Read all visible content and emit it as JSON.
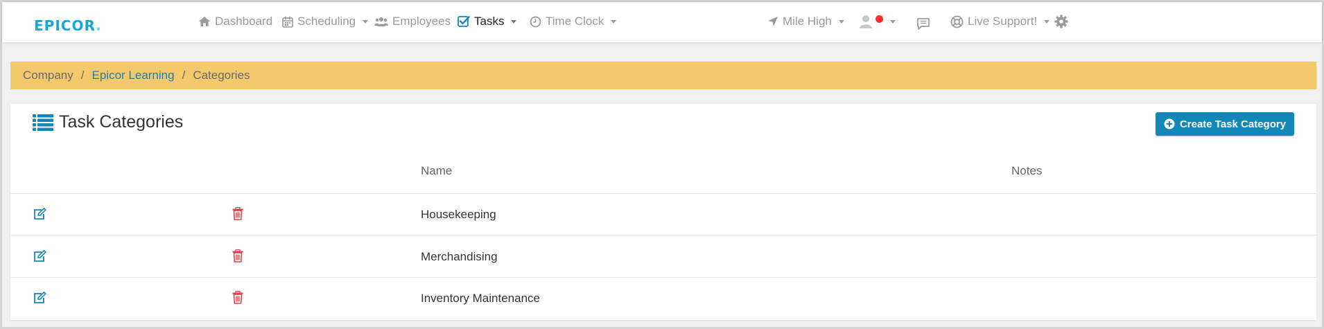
{
  "brand": {
    "logo_text": "EPICOR",
    "logo_mark": "®",
    "logo_color": "#16a9d8"
  },
  "nav": {
    "dashboard": "Dashboard",
    "scheduling": "Scheduling",
    "employees": "Employees",
    "tasks": "Tasks",
    "time_clock": "Time Clock",
    "location": "Mile High",
    "live_support": "Live Support!"
  },
  "breadcrumb": {
    "root": "Company",
    "sep": "/",
    "link": "Epicor Learning",
    "current": "Categories"
  },
  "page": {
    "title": "Task Categories",
    "create_button": "Create Task Category"
  },
  "table": {
    "columns": {
      "name": "Name",
      "notes": "Notes"
    },
    "rows": [
      {
        "name": "Housekeeping",
        "notes": ""
      },
      {
        "name": "Merchandising",
        "notes": ""
      },
      {
        "name": "Inventory Maintenance",
        "notes": ""
      }
    ]
  },
  "colors": {
    "accent": "#1287b8",
    "breadcrumb_bg": "#f4c96b",
    "danger": "#e0414a",
    "status_dot": "#ff2d2d"
  },
  "icons": {
    "dashboard": "home-icon",
    "scheduling": "calendar-icon",
    "employees": "users-icon",
    "tasks": "checkbox-icon",
    "time_clock": "clock-icon",
    "location": "location-arrow-icon",
    "user": "user-avatar-icon",
    "chat": "chat-icon",
    "support": "life-ring-icon",
    "settings": "gear-icon",
    "title": "list-icon",
    "create": "plus-circle-icon",
    "edit": "edit-icon",
    "delete": "trash-icon"
  }
}
